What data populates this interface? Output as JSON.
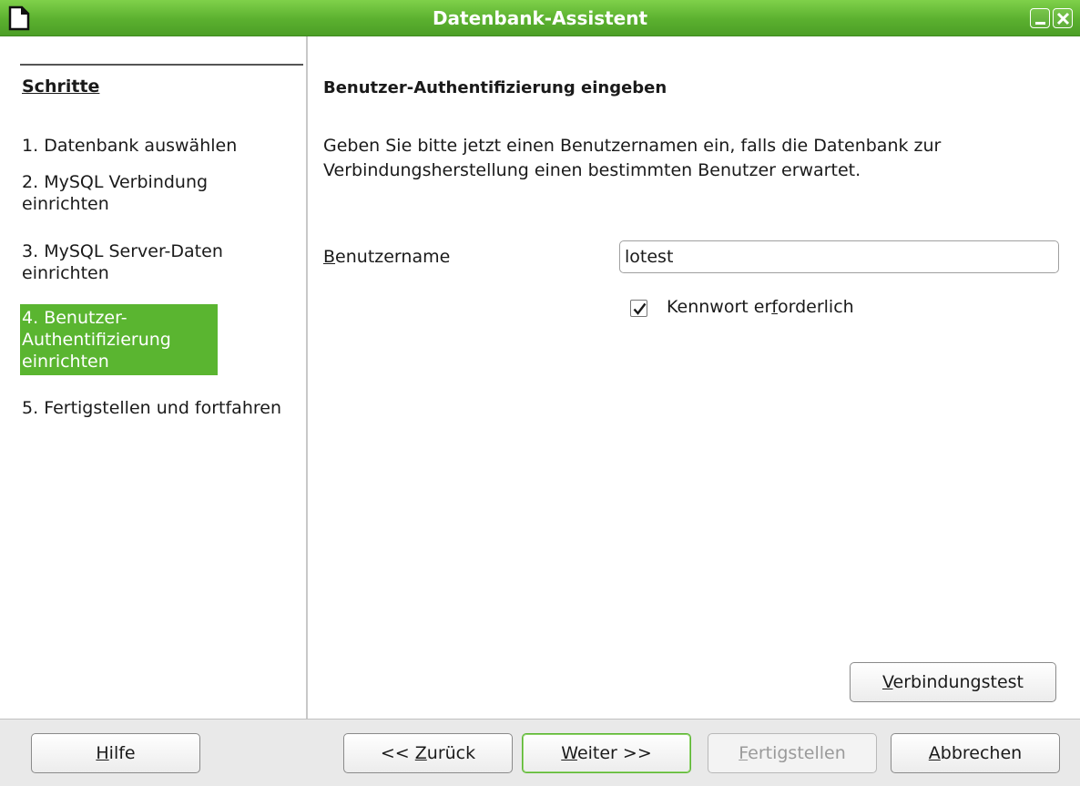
{
  "window": {
    "title": "Datenbank-Assistent",
    "app_icon": "document-icon",
    "title_bar_color": "#5bb02f"
  },
  "steps": {
    "heading": "Schritte",
    "items": [
      {
        "number": "1.",
        "label": "Datenbank auswählen"
      },
      {
        "number": "2.",
        "label": "MySQL Verbindung einrichten"
      },
      {
        "number": "3.",
        "label": "MySQL Server-Daten einrichten"
      },
      {
        "number": "4.",
        "label": "Benutzer-Authentifizierung einrichten",
        "active": true
      },
      {
        "number": "5.",
        "label": "Fertigstellen und fortfahren"
      }
    ],
    "active_color": "#5ab530"
  },
  "main": {
    "section_title": "Benutzer-Authentifizierung eingeben",
    "description": "Geben Sie bitte jetzt einen Benutzernamen ein, falls die Datenbank zur Verbindungsherstellung einen bestimmten Benutzer erwartet.",
    "username_label_mnemonic": "B",
    "username_label_rest": "enutzername",
    "username_value": "lotest",
    "password_required_label_pre": "Kennwort er",
    "password_required_label_mnemonic": "f",
    "password_required_label_post": "orderlich",
    "password_required_checked": true,
    "connection_test_mnemonic": "V",
    "connection_test_rest": "erbindungstest"
  },
  "footer": {
    "help_mnemonic": "H",
    "help_rest": "ilfe",
    "back_pre": "<< ",
    "back_mnemonic": "Z",
    "back_rest": "urück",
    "next_mnemonic": "W",
    "next_rest": "eiter >>",
    "finish_mnemonic": "F",
    "finish_rest": "ertigstellen",
    "finish_enabled": false,
    "cancel_mnemonic": "A",
    "cancel_rest": "bbrechen"
  }
}
